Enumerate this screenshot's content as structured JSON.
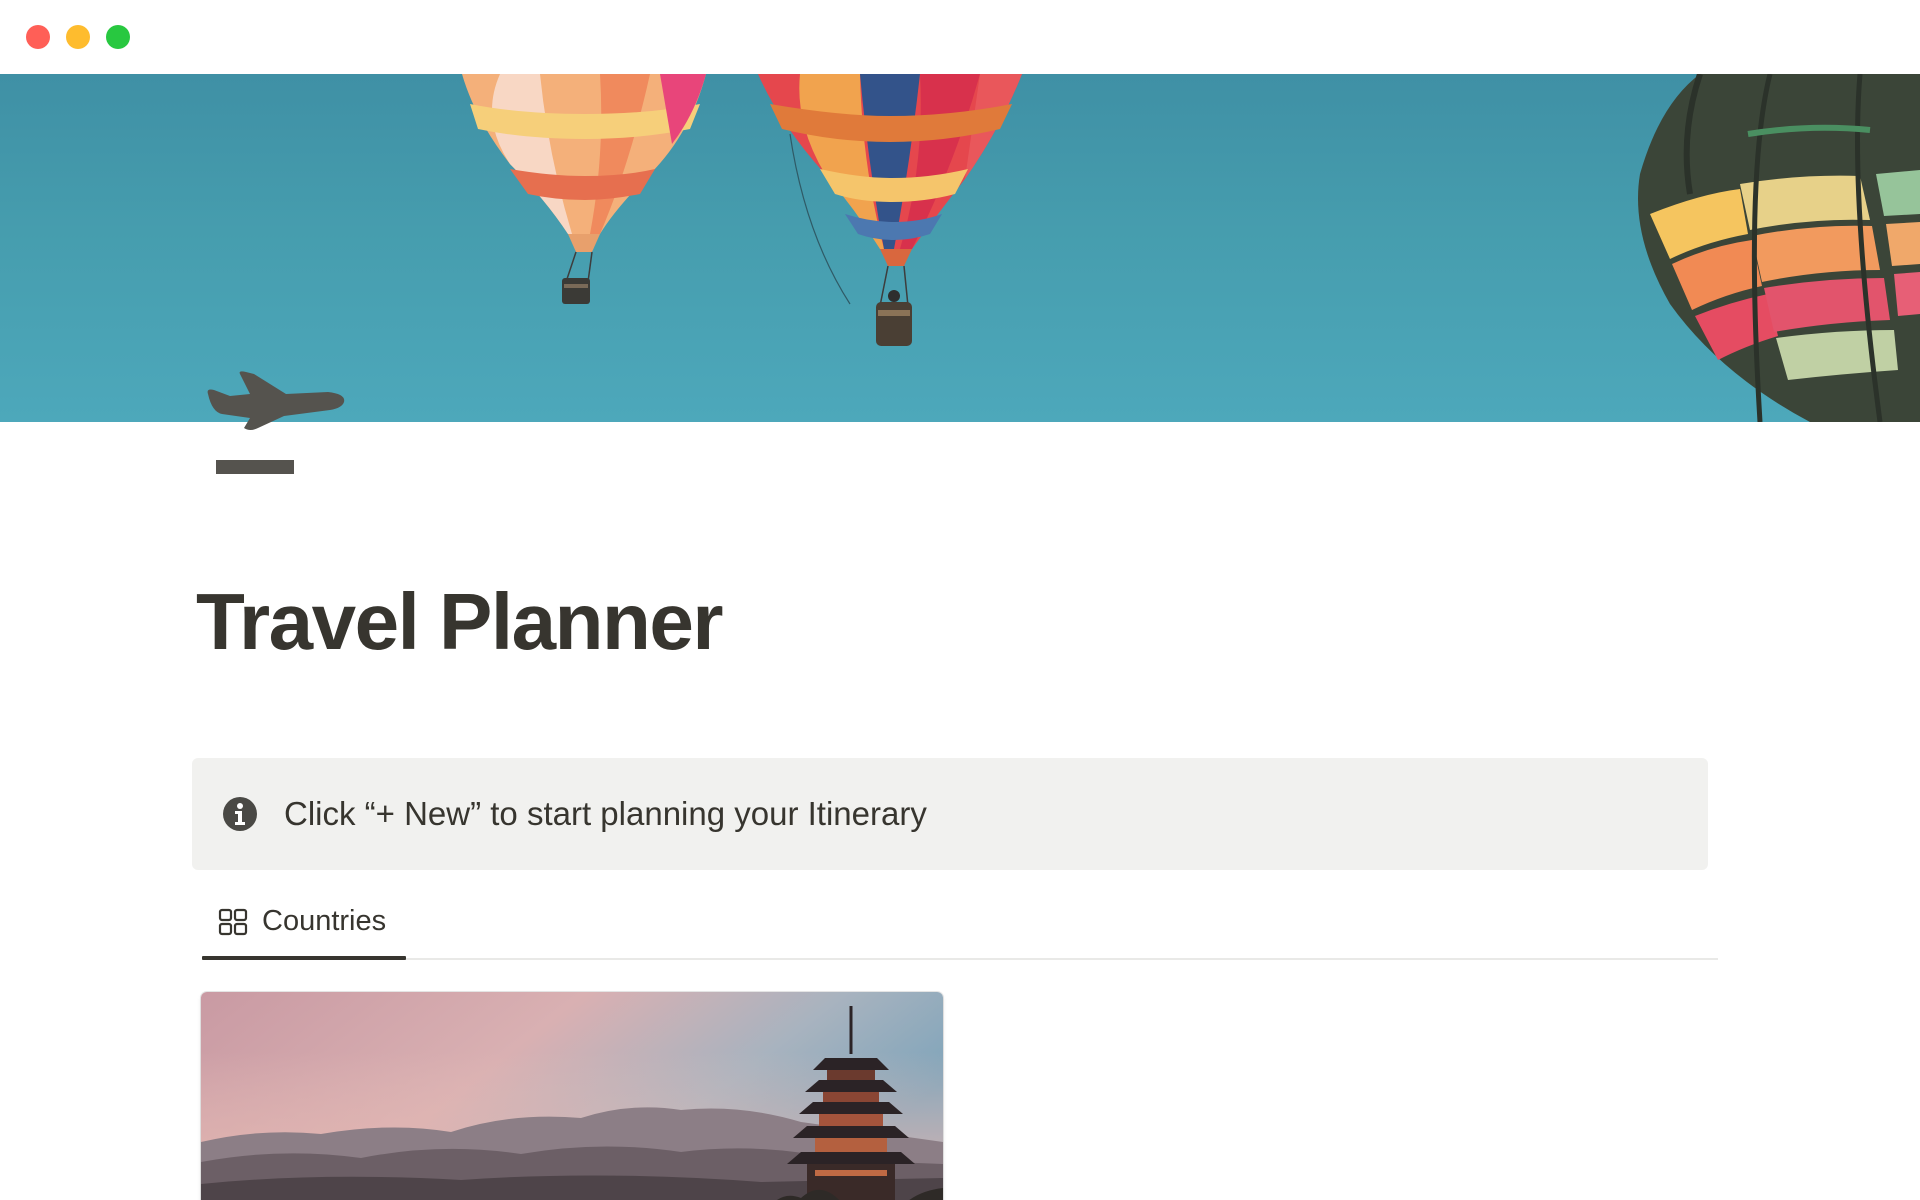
{
  "window": {
    "controls": [
      "close",
      "minimize",
      "zoom"
    ]
  },
  "cover": {
    "description_icon": "hot-air-balloons-cover",
    "sky_color": "#469dae"
  },
  "page": {
    "icon": "airplane-departure-icon",
    "title": "Travel Planner"
  },
  "callout": {
    "icon": "info-icon",
    "text": "Click “+ New” to start planning your Itinerary"
  },
  "database": {
    "views": [
      {
        "icon": "gallery-icon",
        "label": "Countries",
        "active": true
      }
    ],
    "cards": [
      {
        "cover": "pagoda-sunset-cover"
      }
    ]
  },
  "colors": {
    "text": "#37352f",
    "callout_bg": "#f1f1ef",
    "divider": "#e9e9e7",
    "close": "#ff5f57",
    "minimize": "#febc2e",
    "zoom": "#28c840"
  }
}
